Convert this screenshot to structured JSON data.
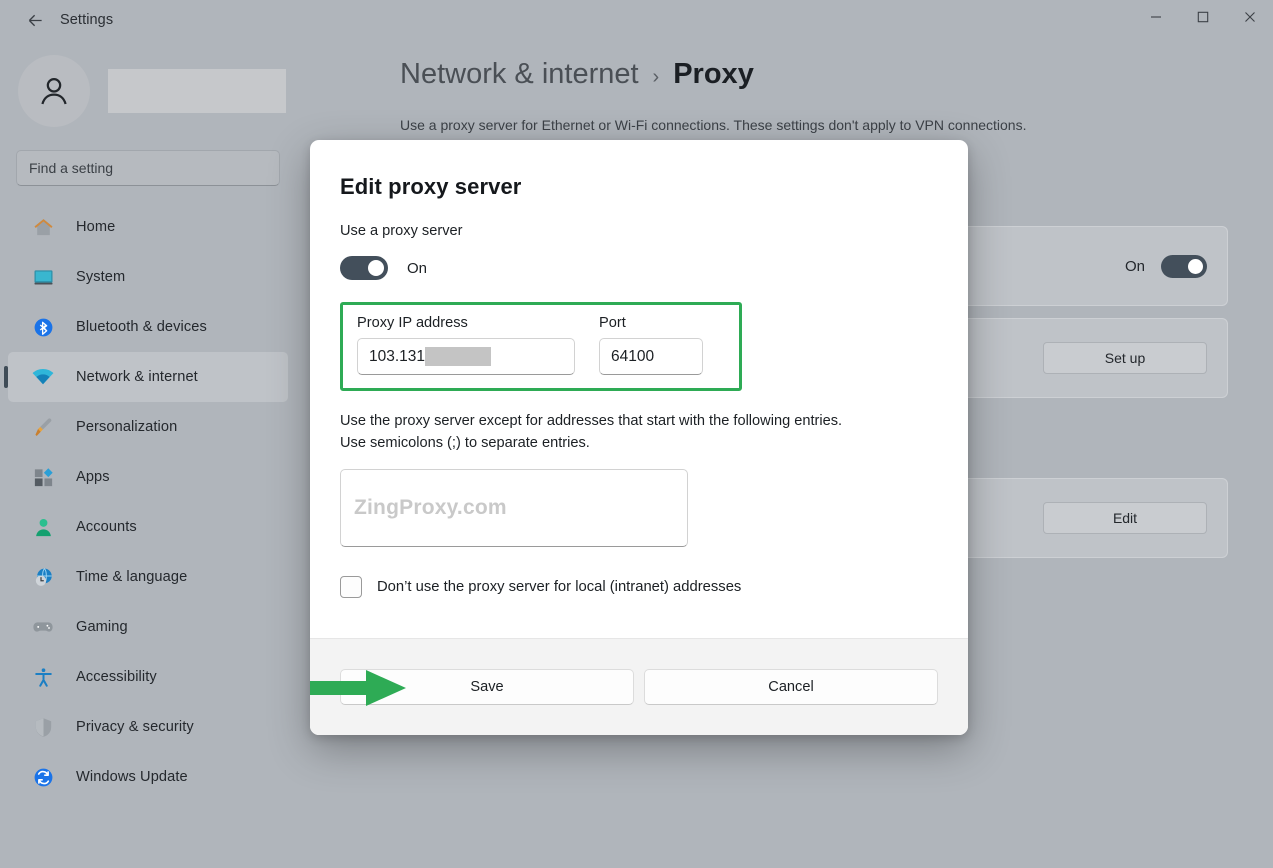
{
  "window": {
    "app_title": "Settings",
    "back_icon": "back-arrow-icon",
    "minimize_label": "—",
    "maximize_label": "□",
    "close_label": "✕"
  },
  "sidebar": {
    "account_name_redacted": "",
    "search": {
      "placeholder": "Find a setting",
      "value": ""
    },
    "items": [
      {
        "label": "Home",
        "icon": "home-icon",
        "active": false
      },
      {
        "label": "System",
        "icon": "system-icon",
        "active": false
      },
      {
        "label": "Bluetooth & devices",
        "icon": "bluetooth-icon",
        "active": false
      },
      {
        "label": "Network & internet",
        "icon": "wifi-icon",
        "active": true
      },
      {
        "label": "Personalization",
        "icon": "paintbrush-icon",
        "active": false
      },
      {
        "label": "Apps",
        "icon": "apps-icon",
        "active": false
      },
      {
        "label": "Accounts",
        "icon": "person-icon",
        "active": false
      },
      {
        "label": "Time & language",
        "icon": "clock-globe-icon",
        "active": false
      },
      {
        "label": "Gaming",
        "icon": "gamepad-icon",
        "active": false
      },
      {
        "label": "Accessibility",
        "icon": "accessibility-icon",
        "active": false
      },
      {
        "label": "Privacy & security",
        "icon": "shield-icon",
        "active": false
      },
      {
        "label": "Windows Update",
        "icon": "update-refresh-icon",
        "active": false
      }
    ]
  },
  "header": {
    "breadcrumb_parent": "Network & internet",
    "breadcrumb_separator": "›",
    "breadcrumb_current": "Proxy",
    "description": "Use a proxy server for Ethernet or Wi-Fi connections. These settings don't apply to VPN connections."
  },
  "background_cards": {
    "auto_detect_toggle_label": "On",
    "setup_script_button": "Set up",
    "manual_proxy_button": "Edit"
  },
  "dialog": {
    "title": "Edit proxy server",
    "use_proxy_label": "Use a proxy server",
    "toggle_state_label": "On",
    "ip_label": "Proxy IP address",
    "ip_value": "103.131",
    "port_label": "Port",
    "port_value": "64100",
    "exceptions_hint_line1": "Use the proxy server except for addresses that start with the following entries.",
    "exceptions_hint_line2": "Use semicolons (;) to separate entries.",
    "exceptions_placeholder": "ZingProxy.com",
    "exceptions_value": "",
    "bypass_local_label": "Don’t use the proxy server for local (intranet) addresses",
    "bypass_local_checked": false,
    "save_label": "Save",
    "cancel_label": "Cancel"
  },
  "annotations": {
    "highlight_color": "#2eab55",
    "arrow_color": "#2eab55",
    "arrow_target": "Save"
  },
  "colors": {
    "backdrop": "#b0b5bb",
    "dialog_bg": "#ffffff",
    "footer_bg": "#f3f3f3",
    "toggle_on": "#434f5b",
    "accent_green": "#2eab55"
  }
}
